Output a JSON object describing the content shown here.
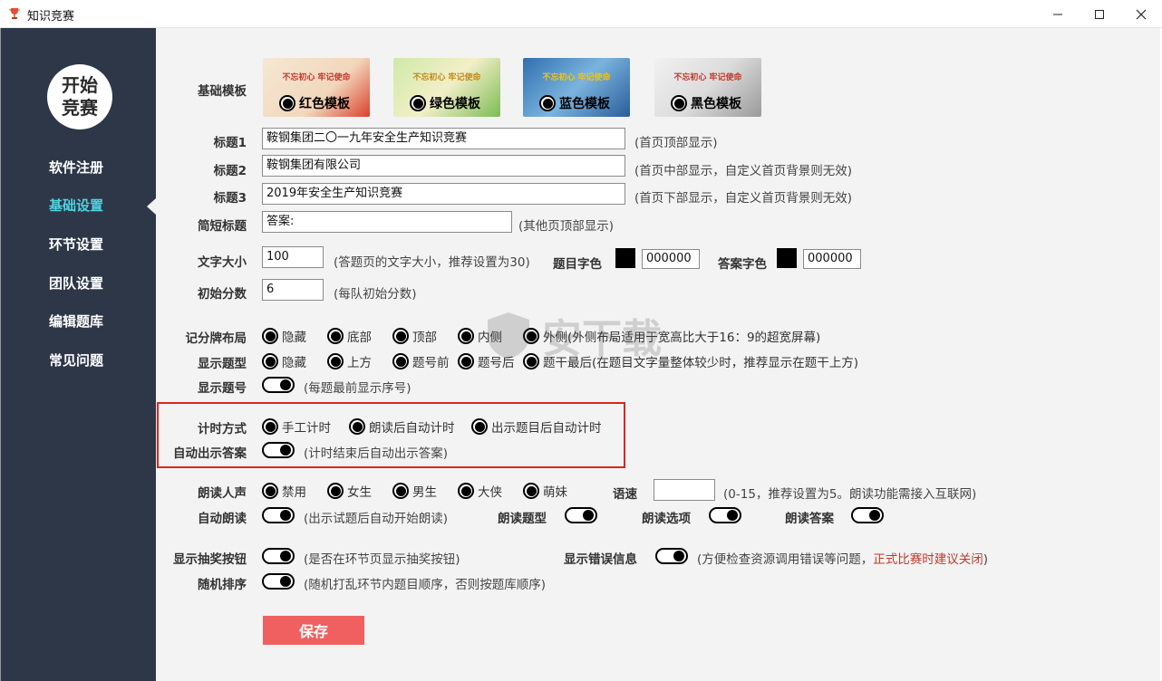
{
  "window": {
    "title": "知识竞赛"
  },
  "sidebar": {
    "logo_text": "开始竞赛",
    "items": [
      {
        "label": "软件注册"
      },
      {
        "label": "基础设置"
      },
      {
        "label": "环节设置"
      },
      {
        "label": "团队设置"
      },
      {
        "label": "编辑题库"
      },
      {
        "label": "常见问题"
      }
    ],
    "active_index": 1
  },
  "templates": {
    "label": "基础模板",
    "items": [
      {
        "label": "红色模板",
        "banner": "不忘初心 牢记使命",
        "color": "#c0392b",
        "selected": true
      },
      {
        "label": "绿色模板",
        "banner": "不忘初心 牢记使命",
        "color": "#4a9a3a",
        "selected": true
      },
      {
        "label": "蓝色模板",
        "banner": "不忘初心 牢记使命",
        "color": "#2f6fb0",
        "selected": true
      },
      {
        "label": "黑色模板",
        "banner": "不忘初心 牢记使命",
        "color": "#555555",
        "selected": true
      }
    ]
  },
  "fields": {
    "title1": {
      "label": "标题1",
      "value": "鞍钢集团二〇一九年安全生产知识竞赛",
      "hint": "(首页顶部显示)"
    },
    "title2": {
      "label": "标题2",
      "value": "鞍钢集团有限公司",
      "hint": "(首页中部显示，自定义首页背景则无效)"
    },
    "title3": {
      "label": "标题3",
      "value": "2019年安全生产知识竞赛",
      "hint": "(首页下部显示，自定义首页背景则无效)"
    },
    "short_title": {
      "label": "简短标题",
      "value": "答案:",
      "hint": "(其他页顶部显示)"
    },
    "font_size": {
      "label": "文字大小",
      "value": "100",
      "hint": "(答题页的文字大小，推荐设置为30)"
    },
    "question_color": {
      "label": "题目字色",
      "value": "000000",
      "color": "#000000"
    },
    "answer_color": {
      "label": "答案字色",
      "value": "000000",
      "color": "#000000"
    },
    "initial_score": {
      "label": "初始分数",
      "value": "6",
      "hint": "(每队初始分数)"
    }
  },
  "scoreboard_layout": {
    "label": "记分牌布局",
    "options": [
      "隐藏",
      "底部",
      "顶部",
      "内侧",
      "外侧"
    ],
    "hint": "(外侧布局适用于宽高比大于16：9的超宽屏幕)"
  },
  "question_type_display": {
    "label": "显示题型",
    "options": [
      "隐藏",
      "上方",
      "题号前",
      "题号后",
      "题干最后"
    ],
    "hint": "(在题目文字量整体较少时，推荐显示在题干上方)"
  },
  "question_number": {
    "label": "显示题号",
    "hint": "(每题最前显示序号)"
  },
  "timing": {
    "label": "计时方式",
    "options": [
      "手工计时",
      "朗读后自动计时",
      "出示题目后自动计时"
    ]
  },
  "auto_answer": {
    "label": "自动出示答案",
    "hint": "(计时结束后自动出示答案)"
  },
  "voice": {
    "label": "朗读人声",
    "options": [
      "禁用",
      "女生",
      "男生",
      "大侠",
      "萌妹"
    ]
  },
  "speed": {
    "label": "语速",
    "value": "",
    "hint": "(0-15，推荐设置为5。朗读功能需接入互联网)"
  },
  "auto_read": {
    "label": "自动朗读",
    "hint": "(出示试题后自动开始朗读)"
  },
  "read_type": {
    "label": "朗读题型"
  },
  "read_options": {
    "label": "朗读选项"
  },
  "read_answer": {
    "label": "朗读答案"
  },
  "lottery_button": {
    "label": "显示抽奖按钮",
    "hint": "(是否在环节页显示抽奖按钮)"
  },
  "error_info": {
    "label": "显示错误信息",
    "hint": "(方便检查资源调用错误等问题，",
    "hint_warn": "正式比赛时建议关闭",
    "hint_end": ")"
  },
  "shuffle": {
    "label": "随机排序",
    "hint": "(随机打乱环节内题目顺序，否则按题库顺序)"
  },
  "save_label": "保存",
  "watermark": "安下载"
}
